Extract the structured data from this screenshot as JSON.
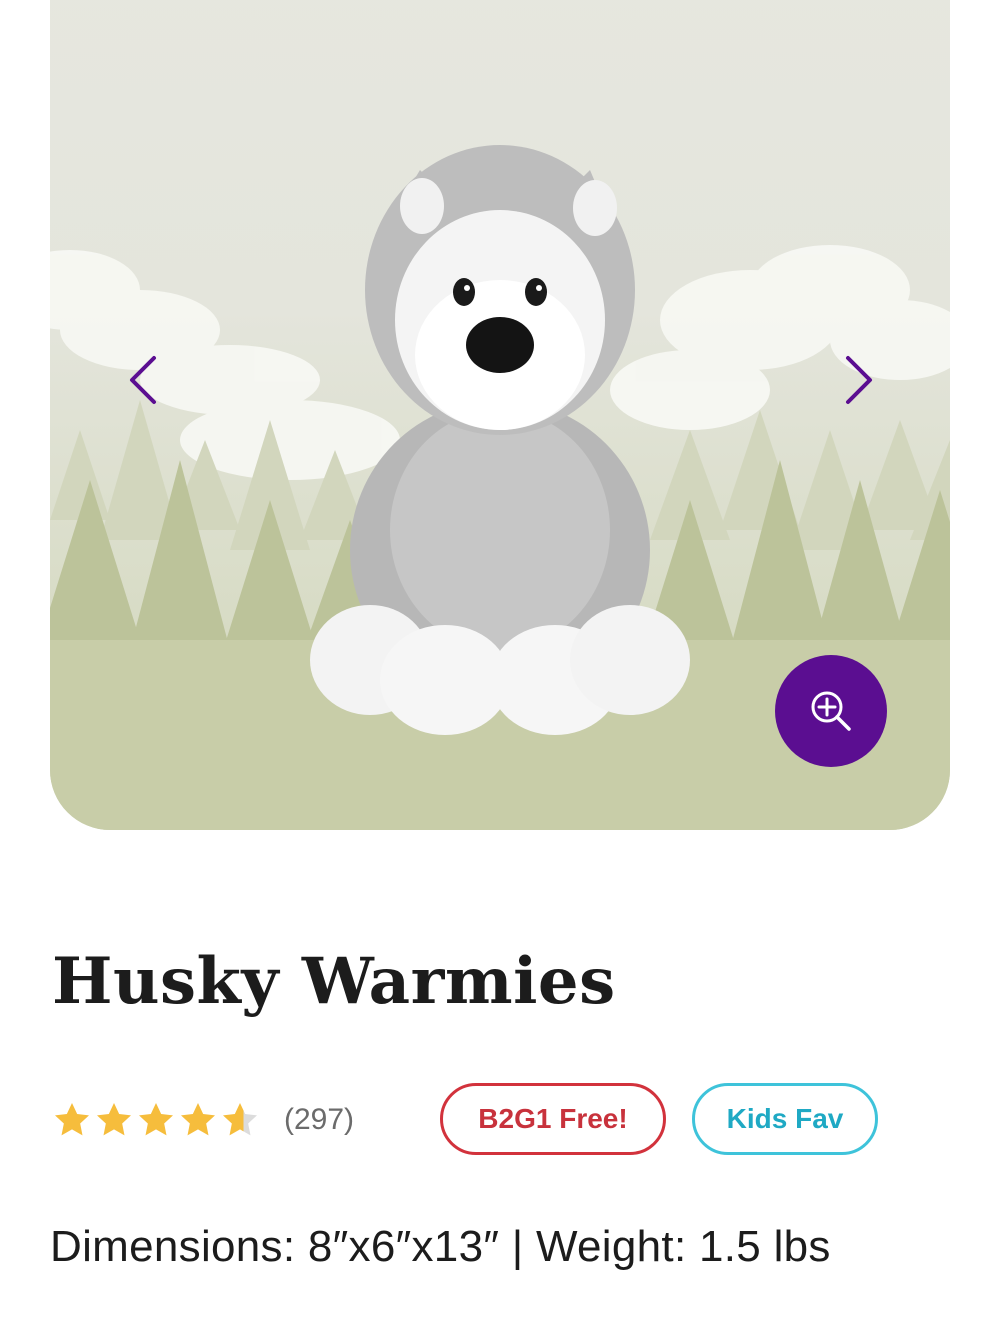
{
  "product": {
    "title": "Husky Warmies",
    "rating": {
      "stars": 4.5,
      "max": 5,
      "count_label": "(297)"
    },
    "badges": [
      {
        "label": "B2G1 Free!",
        "color": "#d2323c"
      },
      {
        "label": "Kids Fav",
        "color": "#3ec3da"
      }
    ],
    "specs": "Dimensions: 8″x6″x13″ | Weight: 1.5 lbs"
  },
  "gallery": {
    "prev_icon": "chevron-left-icon",
    "next_icon": "chevron-right-icon",
    "zoom_icon": "zoom-in-icon",
    "accent_color": "#5b0e91"
  },
  "colors": {
    "star": "#f6bd3c",
    "title": "#1c1c1c"
  }
}
